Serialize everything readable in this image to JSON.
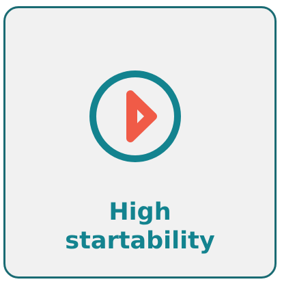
{
  "feature": {
    "label_line_1": "High",
    "label_line_2": "startability",
    "icon": "play-icon"
  },
  "colors": {
    "border": "#1a6b73",
    "background": "#f1f1f1",
    "ring": "#13838f",
    "text": "#13838f",
    "play": "#f05b47"
  }
}
